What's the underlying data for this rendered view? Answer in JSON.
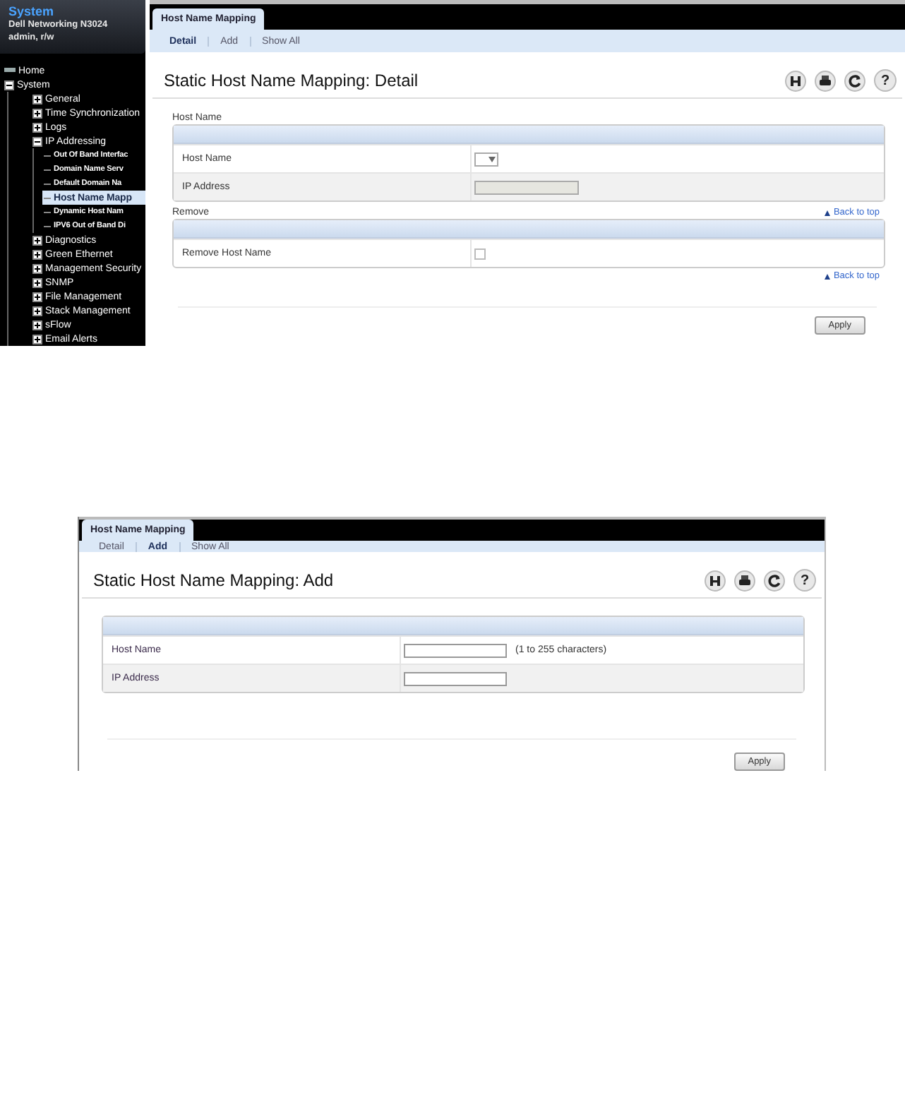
{
  "detail_screen": {
    "sidebar": {
      "title": "System",
      "device": "Dell Networking N3024",
      "user": "admin, r/w",
      "tree": [
        {
          "label": "Home",
          "kind": "home",
          "selected": false
        },
        {
          "label": "System",
          "kind": "folder",
          "expanded": true,
          "selected": false,
          "children": [
            {
              "label": "General",
              "kind": "folder",
              "expanded": false,
              "selected": false
            },
            {
              "label": "Time Synchronization",
              "kind": "folder",
              "expanded": false,
              "selected": false
            },
            {
              "label": "Logs",
              "kind": "folder",
              "expanded": false,
              "selected": false
            },
            {
              "label": "IP Addressing",
              "kind": "folder",
              "expanded": true,
              "selected": false,
              "children": [
                {
                  "label": "Out Of Band Interfac",
                  "kind": "leaf",
                  "selected": false
                },
                {
                  "label": "Domain Name Serv",
                  "kind": "leaf",
                  "selected": false
                },
                {
                  "label": "Default Domain Na",
                  "kind": "leaf",
                  "selected": false
                },
                {
                  "label": "Host Name Mapp",
                  "kind": "leaf",
                  "selected": true
                },
                {
                  "label": "Dynamic Host Nam",
                  "kind": "leaf",
                  "selected": false
                },
                {
                  "label": "IPV6 Out of Band Di",
                  "kind": "leaf",
                  "selected": false
                }
              ]
            },
            {
              "label": "Diagnostics",
              "kind": "folder",
              "expanded": false,
              "selected": false
            },
            {
              "label": "Green Ethernet",
              "kind": "folder",
              "expanded": false,
              "selected": false
            },
            {
              "label": "Management Security",
              "kind": "folder",
              "expanded": false,
              "selected": false
            },
            {
              "label": "SNMP",
              "kind": "folder",
              "expanded": false,
              "selected": false
            },
            {
              "label": "File Management",
              "kind": "folder",
              "expanded": false,
              "selected": false
            },
            {
              "label": "Stack Management",
              "kind": "folder",
              "expanded": false,
              "selected": false
            },
            {
              "label": "sFlow",
              "kind": "folder",
              "expanded": false,
              "selected": false
            },
            {
              "label": "Email Alerts",
              "kind": "folder",
              "expanded": false,
              "selected": false
            }
          ]
        }
      ]
    },
    "page_tab": "Host Name Mapping",
    "subtabs": [
      {
        "label": "Detail",
        "selected": true
      },
      {
        "label": "Add",
        "selected": false
      },
      {
        "label": "Show All",
        "selected": false
      }
    ],
    "heading": "Static Host Name Mapping: Detail",
    "help_glyph": "?",
    "sections": [
      {
        "label": "Host Name",
        "rows": [
          {
            "label": "Host Name",
            "kind": "dropdown"
          },
          {
            "label": "IP Address",
            "kind": "readonly"
          }
        ]
      },
      {
        "label": "Remove",
        "back_link": "Back to top",
        "rows": [
          {
            "label": "Remove Host Name",
            "kind": "checkbox",
            "checked": false
          }
        ]
      }
    ],
    "footer_link": "Back to top",
    "apply": "Apply"
  },
  "add_screen": {
    "page_tab": "Host Name Mapping",
    "subtabs": [
      {
        "label": "Detail",
        "selected": false
      },
      {
        "label": "Add",
        "selected": true
      },
      {
        "label": "Show All",
        "selected": false
      }
    ],
    "heading": "Static Host Name Mapping: Add",
    "help_glyph": "?",
    "sections": [
      {
        "rows": [
          {
            "label": "Host Name",
            "kind": "text",
            "hint": "(1 to 255 characters)"
          },
          {
            "label": "IP Address",
            "kind": "text"
          }
        ]
      }
    ],
    "apply": "Apply"
  }
}
